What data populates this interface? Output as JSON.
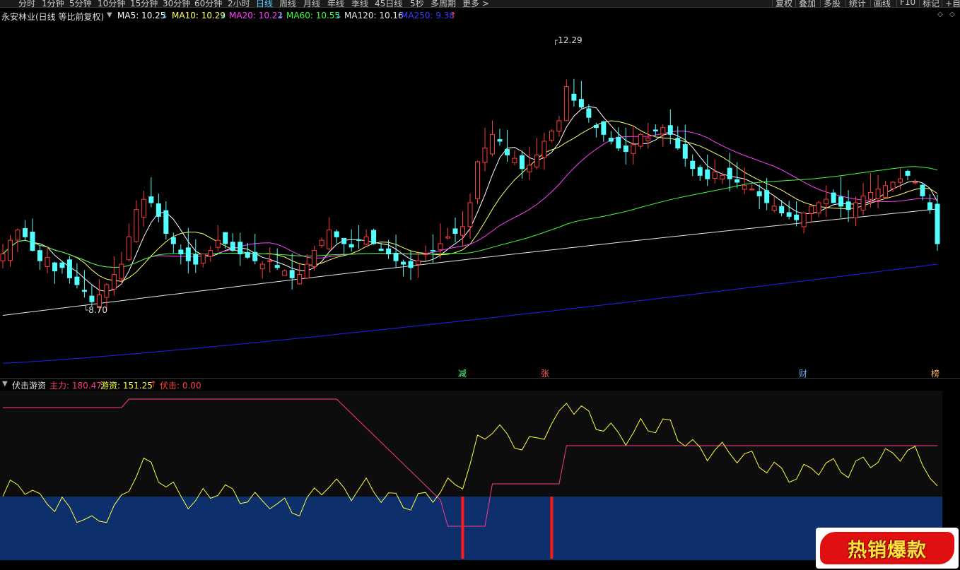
{
  "toolbar": {
    "items": [
      "分时",
      "1分钟",
      "5分钟",
      "10分钟",
      "15分钟",
      "30分钟",
      "60分钟",
      "2小时",
      "日线",
      "周线",
      "月线",
      "年线",
      "季线",
      "45日线",
      "5秒",
      "多周期",
      "更多 >"
    ],
    "active": "日线",
    "right_items": [
      "复权",
      "叠加",
      "多股",
      "统计",
      "画线",
      "F10",
      "标记",
      "+自"
    ]
  },
  "main_header": {
    "stock_name": "永安林业(日线 等比前复权)",
    "ma5": "MA5: 10.25",
    "ma10": "MA10: 10.29",
    "ma20": "MA20: 10.22",
    "ma60": "MA60: 10.55",
    "ma120": "MA120: 10.16",
    "ma250": "MA250: 9.38",
    "arrow_down": "↓",
    "arrow_up": "↑"
  },
  "price_labels": {
    "high": "12.29",
    "low": "8.70"
  },
  "signals": [
    "减",
    "张",
    "财",
    "榜"
  ],
  "sub_header": {
    "indicator_name": "伏击游资",
    "zhuli": "主力: 180.47",
    "youzi": "游资: 151.25",
    "youzi_arrow": "↑",
    "fuji": "伏击: 0.00"
  },
  "badge": {
    "text": "热销爆款"
  },
  "colors": {
    "up_candle": "#ff3c3c",
    "down_candle": "#54ffff",
    "ma5": "#ffffff",
    "ma10": "#ffff66",
    "ma20": "#ff40ff",
    "ma60": "#40ff40",
    "ma120": "#e6e6e6",
    "ma250": "#2020ff",
    "zhuli_line": "#ff3a8c",
    "youzi_line": "#ffff40",
    "fuji_bar": "#ff1a1a",
    "zone_fill": "#0d2f6b"
  },
  "chart_data": {
    "type": "candlestick",
    "close_prices": [
      9.55,
      9.75,
      9.9,
      9.8,
      9.6,
      9.45,
      9.5,
      9.3,
      9.35,
      9.2,
      9.1,
      9.0,
      8.85,
      8.95,
      9.1,
      9.25,
      9.4,
      9.8,
      10.2,
      10.35,
      10.3,
      10.1,
      9.85,
      9.7,
      9.55,
      9.45,
      9.4,
      9.55,
      9.6,
      9.75,
      9.7,
      9.6,
      9.55,
      9.5,
      9.45,
      9.4,
      9.45,
      9.35,
      9.3,
      9.2,
      9.25,
      9.4,
      9.6,
      9.75,
      9.9,
      9.8,
      9.7,
      9.65,
      9.75,
      9.8,
      9.7,
      9.6,
      9.55,
      9.45,
      9.4,
      9.35,
      9.45,
      9.55,
      9.6,
      9.7,
      9.8,
      9.85,
      9.95,
      10.3,
      10.9,
      11.1,
      11.3,
      11.2,
      11.0,
      10.95,
      10.8,
      10.85,
      11.0,
      11.2,
      11.35,
      11.5,
      12.0,
      11.8,
      11.7,
      11.55,
      11.4,
      11.3,
      11.2,
      11.1,
      11.05,
      11.15,
      11.3,
      11.25,
      11.35,
      11.4,
      11.3,
      11.1,
      10.95,
      10.8,
      10.7,
      10.65,
      10.75,
      10.7,
      10.65,
      10.6,
      10.55,
      10.5,
      10.4,
      10.3,
      10.25,
      10.15,
      10.1,
      10.05,
      10.15,
      10.25,
      10.3,
      10.35,
      10.3,
      10.25,
      10.2,
      10.3,
      10.4,
      10.45,
      10.5,
      10.55,
      10.6,
      10.65,
      10.7,
      10.6,
      10.4,
      10.2,
      9.7
    ]
  }
}
